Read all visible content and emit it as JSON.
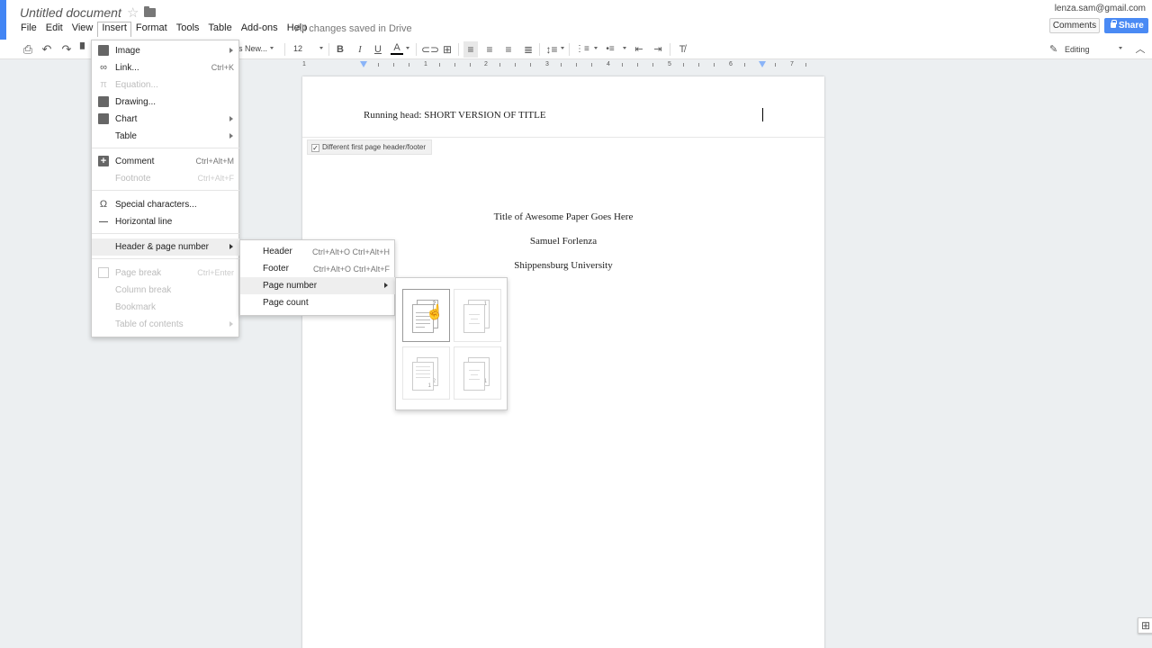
{
  "app": {
    "doc_title": "Untitled document",
    "save_status": "All changes saved in Drive",
    "account": "lenza.sam@gmail.com",
    "comments_label": "Comments",
    "share_label": "Share",
    "accent_color": "#4285f4"
  },
  "menubar": [
    "File",
    "Edit",
    "View",
    "Insert",
    "Format",
    "Tools",
    "Table",
    "Add-ons",
    "Help"
  ],
  "toolbar": {
    "font": "s New...",
    "font_size": "12",
    "mode": "Editing"
  },
  "ruler": {
    "numbers": [
      "1",
      "1",
      "2",
      "3",
      "4",
      "5",
      "6",
      "7"
    ]
  },
  "document": {
    "running_head": "Running head: SHORT VERSION OF TITLE",
    "different_first_page": "Different first page header/footer",
    "title_line": "Title of Awesome Paper Goes Here",
    "author": "Samuel Forlenza",
    "institution": "Shippensburg University"
  },
  "insert_menu": {
    "items": [
      {
        "label": "Image",
        "shortcut": "",
        "icon": "image-icon",
        "submenu": true,
        "enabled": true
      },
      {
        "label": "Link...",
        "shortcut": "Ctrl+K",
        "icon": "link-icon",
        "submenu": false,
        "enabled": true
      },
      {
        "label": "Equation...",
        "shortcut": "",
        "icon": "pi-icon",
        "submenu": false,
        "enabled": false
      },
      {
        "label": "Drawing...",
        "shortcut": "",
        "icon": "drawing-icon",
        "submenu": false,
        "enabled": true
      },
      {
        "label": "Chart",
        "shortcut": "",
        "icon": "chart-icon",
        "submenu": true,
        "enabled": true
      },
      {
        "label": "Table",
        "shortcut": "",
        "icon": "",
        "submenu": true,
        "enabled": true
      },
      {
        "label": "Comment",
        "shortcut": "Ctrl+Alt+M",
        "icon": "add-comment-icon",
        "submenu": false,
        "enabled": true
      },
      {
        "label": "Footnote",
        "shortcut": "Ctrl+Alt+F",
        "icon": "",
        "submenu": false,
        "enabled": false
      },
      {
        "label": "Special characters...",
        "shortcut": "",
        "icon": "omega-icon",
        "submenu": false,
        "enabled": true
      },
      {
        "label": "Horizontal line",
        "shortcut": "",
        "icon": "horizontal-line-icon",
        "submenu": false,
        "enabled": true
      },
      {
        "label": "Header & page number",
        "shortcut": "",
        "icon": "",
        "submenu": true,
        "enabled": true
      },
      {
        "label": "Page break",
        "shortcut": "Ctrl+Enter",
        "icon": "page-break-icon",
        "submenu": false,
        "enabled": false
      },
      {
        "label": "Column break",
        "shortcut": "",
        "icon": "",
        "submenu": false,
        "enabled": false
      },
      {
        "label": "Bookmark",
        "shortcut": "",
        "icon": "",
        "submenu": false,
        "enabled": false
      },
      {
        "label": "Table of contents",
        "shortcut": "",
        "icon": "",
        "submenu": true,
        "enabled": false
      }
    ]
  },
  "header_submenu": {
    "items": [
      {
        "label": "Header",
        "shortcut": "Ctrl+Alt+O Ctrl+Alt+H",
        "submenu": false
      },
      {
        "label": "Footer",
        "shortcut": "Ctrl+Alt+O Ctrl+Alt+F",
        "submenu": false
      },
      {
        "label": "Page number",
        "shortcut": "",
        "submenu": true
      },
      {
        "label": "Page count",
        "shortcut": "",
        "submenu": false
      }
    ]
  },
  "page_number_options": [
    {
      "name": "top-right-all-pages",
      "page_numbers": [
        "2"
      ]
    },
    {
      "name": "top-right-skip-first",
      "page_numbers": [
        "1"
      ]
    },
    {
      "name": "bottom-right-all-pages",
      "page_numbers": [
        "1",
        "2"
      ]
    },
    {
      "name": "bottom-right-skip-first",
      "page_numbers": [
        "1"
      ]
    }
  ]
}
